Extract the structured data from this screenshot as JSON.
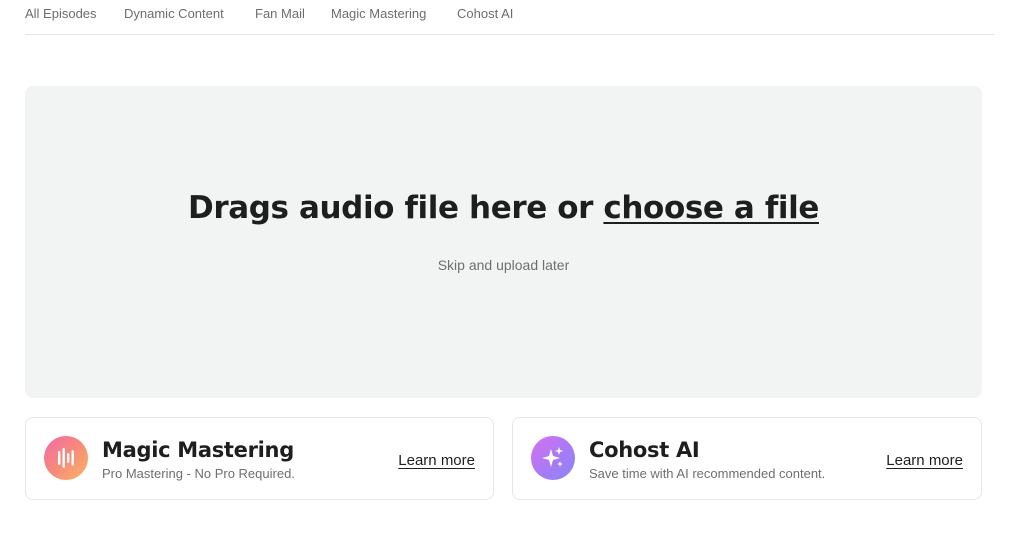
{
  "tabs": [
    {
      "label": "All Episodes"
    },
    {
      "label": "Dynamic Content"
    },
    {
      "label": "Fan Mail"
    },
    {
      "label": "Magic Mastering"
    },
    {
      "label": "Cohost AI"
    }
  ],
  "dropzone": {
    "title_prefix": "Drags audio file here or ",
    "title_link": "choose a file",
    "skip_label": "Skip and upload later"
  },
  "cards": [
    {
      "title": "Magic Mastering",
      "subtitle": "Pro Mastering - No Pro Required.",
      "link": "Learn more",
      "icon": "waveform-icon",
      "gradient": [
        "#f06aa8",
        "#fbb664"
      ]
    },
    {
      "title": "Cohost AI",
      "subtitle": "Save time with AI recommended content.",
      "link": "Learn more",
      "icon": "sparkle-icon",
      "gradient": [
        "#d86ff0",
        "#8b86f7"
      ]
    }
  ]
}
